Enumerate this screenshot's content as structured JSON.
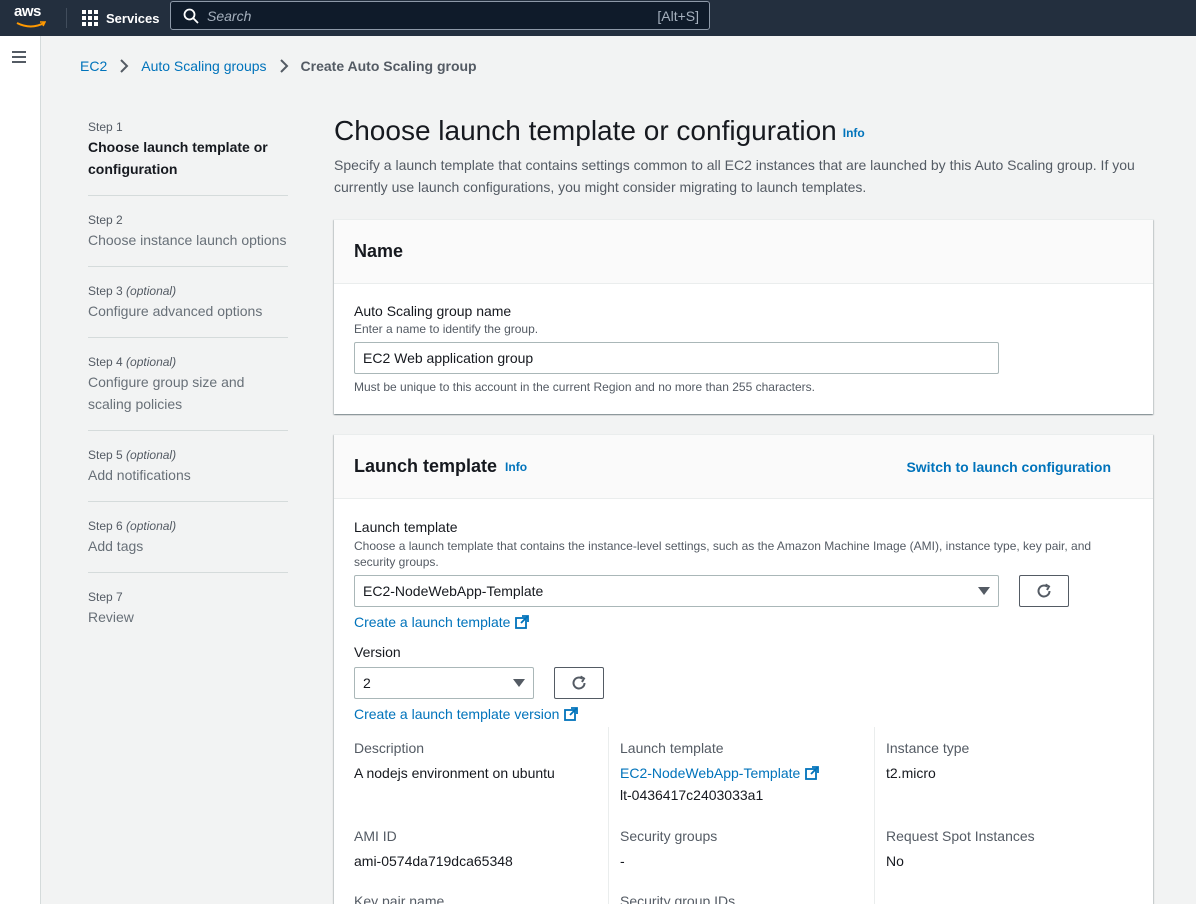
{
  "topnav": {
    "logo_text": "aws",
    "services_label": "Services",
    "search_placeholder": "Search",
    "search_shortcut": "[Alt+S]"
  },
  "breadcrumb": {
    "items": [
      "EC2",
      "Auto Scaling groups"
    ],
    "current": "Create Auto Scaling group"
  },
  "steps": [
    {
      "label": "Step 1",
      "optional": "",
      "title": "Choose launch template or configuration",
      "active": true
    },
    {
      "label": "Step 2",
      "optional": "",
      "title": "Choose instance launch options",
      "active": false
    },
    {
      "label": "Step 3",
      "optional": "(optional)",
      "title": "Configure advanced options",
      "active": false
    },
    {
      "label": "Step 4",
      "optional": "(optional)",
      "title": "Configure group size and scaling policies",
      "active": false
    },
    {
      "label": "Step 5",
      "optional": "(optional)",
      "title": "Add notifications",
      "active": false
    },
    {
      "label": "Step 6",
      "optional": "(optional)",
      "title": "Add tags",
      "active": false
    },
    {
      "label": "Step 7",
      "optional": "",
      "title": "Review",
      "active": false
    }
  ],
  "page": {
    "title": "Choose launch template or configuration",
    "info": "Info",
    "description": "Specify a launch template that contains settings common to all EC2 instances that are launched by this Auto Scaling group. If you currently use launch configurations, you might consider migrating to launch templates."
  },
  "name_panel": {
    "header": "Name",
    "field_label": "Auto Scaling group name",
    "field_desc": "Enter a name to identify the group.",
    "field_value": "EC2 Web application group",
    "field_hint": "Must be unique to this account in the current Region and no more than 255 characters."
  },
  "launch_panel": {
    "header": "Launch template",
    "info": "Info",
    "switch_link": "Switch to launch configuration",
    "template_label": "Launch template",
    "template_desc": "Choose a launch template that contains the instance-level settings, such as the Amazon Machine Image (AMI), instance type, key pair, and security groups.",
    "template_value": "EC2-NodeWebApp-Template",
    "create_template_link": "Create a launch template",
    "version_label": "Version",
    "version_value": "2",
    "create_version_link": "Create a launch template version",
    "details": {
      "description_label": "Description",
      "description_value": "A nodejs environment on ubuntu",
      "launch_template_label": "Launch template",
      "launch_template_name": "EC2-NodeWebApp-Template",
      "launch_template_id": "lt-0436417c2403033a1",
      "instance_type_label": "Instance type",
      "instance_type_value": "t2.micro",
      "ami_label": "AMI ID",
      "ami_value": "ami-0574da719dca65348",
      "security_groups_label": "Security groups",
      "security_groups_value": "-",
      "spot_label": "Request Spot Instances",
      "spot_value": "No",
      "key_pair_label": "Key pair name",
      "security_group_ids_label": "Security group IDs"
    }
  }
}
